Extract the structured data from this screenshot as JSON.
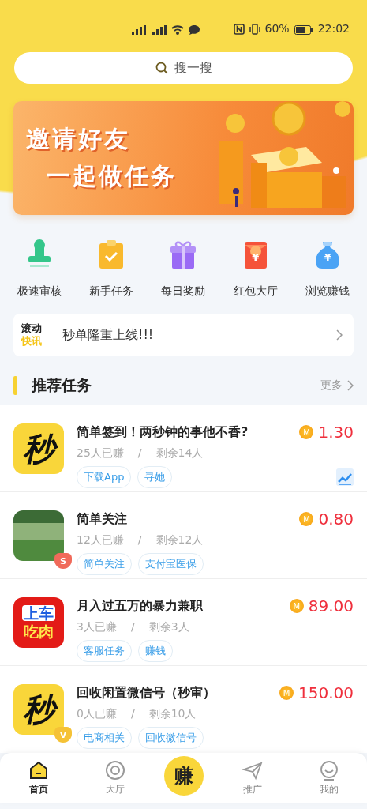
{
  "status_bar": {
    "battery": "60%",
    "time": "22:02"
  },
  "search": {
    "placeholder": "搜一搜"
  },
  "banner": {
    "lines": [
      "邀请好友",
      "一起做任务"
    ]
  },
  "shortcuts": [
    {
      "label": "极速审核",
      "kind": "stamp"
    },
    {
      "label": "新手任务",
      "kind": "clipboard"
    },
    {
      "label": "每日奖励",
      "kind": "gift"
    },
    {
      "label": "红包大厅",
      "kind": "envelope",
      "symbol": "¥"
    },
    {
      "label": "浏览赚钱",
      "kind": "bag",
      "symbol": "¥"
    }
  ],
  "news": {
    "badge_lines": [
      "滚动",
      "快讯"
    ],
    "text": "秒单隆重上线!!!"
  },
  "section": {
    "title": "推荐任务",
    "more": "更多"
  },
  "tasks": [
    {
      "title": "简单签到！两秒钟的事他不香?",
      "thumb": {
        "kind": "miao",
        "lines": [
          "秒"
        ]
      },
      "earned": "25人已赚",
      "separator": "/",
      "remaining": "剩余14人",
      "tags": [
        "下载App",
        "寻她"
      ],
      "coin": "M",
      "price": "1.30",
      "trend": true
    },
    {
      "title": "简单关注",
      "thumb": {
        "kind": "photo"
      },
      "badge": {
        "kind": "shield",
        "text": "S"
      },
      "earned": "12人已赚",
      "separator": "/",
      "remaining": "剩余12人",
      "tags": [
        "简单关注",
        "支付宝医保"
      ],
      "coin": "M",
      "price": "0.80",
      "trend": false
    },
    {
      "title": "月入过五万的暴力兼职",
      "thumb": {
        "kind": "red",
        "lines": [
          "上车",
          "吃肉"
        ]
      },
      "earned": "3人已赚",
      "separator": "/",
      "remaining": "剩余3人",
      "tags": [
        "客服任务",
        "赚钱"
      ],
      "coin": "M",
      "price": "89.00",
      "trend": false
    },
    {
      "title": "回收闲置微信号（秒审）",
      "thumb": {
        "kind": "miao",
        "lines": [
          "秒"
        ]
      },
      "badge": {
        "kind": "gold",
        "text": "V"
      },
      "earned": "0人已赚",
      "separator": "/",
      "remaining": "剩余10人",
      "tags": [
        "电商相关",
        "回收微信号"
      ],
      "coin": "M",
      "price": "150.00",
      "trend": false
    }
  ],
  "nav": [
    {
      "kind": "home",
      "label": "首页",
      "selected": true
    },
    {
      "kind": "target",
      "label": "大厅",
      "selected": false
    },
    {
      "kind": "center",
      "text": "赚"
    },
    {
      "kind": "plane",
      "label": "推广",
      "selected": false
    },
    {
      "kind": "face",
      "label": "我的",
      "selected": false
    }
  ]
}
